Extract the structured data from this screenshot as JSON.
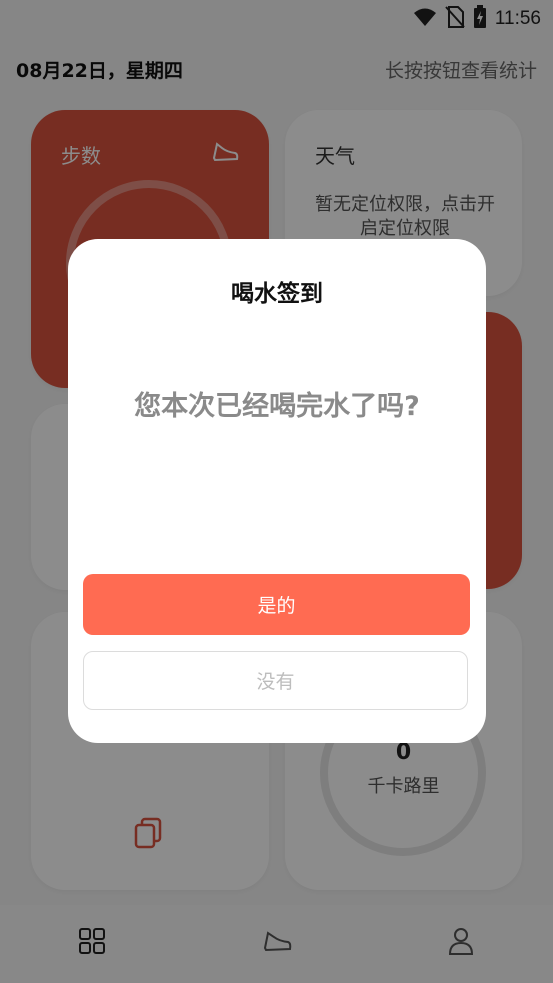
{
  "status": {
    "time": "11:56",
    "icons": [
      "wifi-icon",
      "no-sim-icon",
      "battery-charging-icon"
    ]
  },
  "header": {
    "date": "08月22日，星期四",
    "hint": "长按按钮查看统计"
  },
  "cards": {
    "steps": {
      "title": "步数",
      "icon": "shoe-icon"
    },
    "weather": {
      "title": "天气",
      "message": "暂无定位权限，点击开启定位权限"
    },
    "calories": {
      "value": "0",
      "unit": "千卡路里"
    }
  },
  "dialog": {
    "title": "喝水签到",
    "question": "您本次已经喝完水了吗?",
    "yes_label": "是的",
    "no_label": "没有"
  },
  "bottom_nav": {
    "items": [
      "grid-icon",
      "shoe-icon",
      "person-icon"
    ]
  },
  "colors": {
    "accent": "#ff6b52",
    "card_red": "#d9533f",
    "text_grey": "#8a8a8a"
  }
}
